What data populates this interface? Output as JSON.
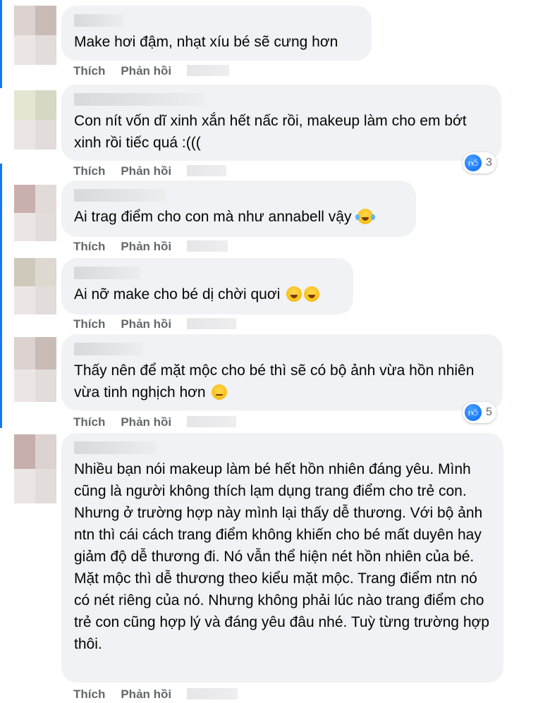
{
  "comments": [
    {
      "text": "Make hơi đậm, nhạt xíu bé sẽ cưng hơn",
      "like_label": "Thích",
      "reply_label": "Phản hồi"
    },
    {
      "text": "Con nít vốn dĩ xinh xắn hết nấc rồi, makeup làm cho em bớt xinh rồi tiếc quá :(((",
      "like_label": "Thích",
      "reply_label": "Phản hồi",
      "reaction_count": "3"
    },
    {
      "text": "Ai trag điểm cho con mà như annabell vậy",
      "like_label": "Thích",
      "reply_label": "Phản hồi",
      "emoji": "laughing-crying-emoji"
    },
    {
      "text": "Ai nỡ make cho bé dị chời quơi",
      "like_label": "Thích",
      "reply_label": "Phản hồi",
      "emoji": "grinning-squinting-emoji"
    },
    {
      "text": "Thấy nên để mặt mộc cho bé thì sẽ có bộ ảnh vừa hồn nhiên vừa tinh nghịch hơn",
      "like_label": "Thích",
      "reply_label": "Phản hồi",
      "reaction_count": "5",
      "emoji": "relieved-face-emoji"
    },
    {
      "text": "Nhiều bạn nói makeup làm bé hết hồn nhiên đáng yêu. Mình cũng là người không thích lạm dụng trang điểm cho trẻ con. Nhưng ở trường hợp này mình lại thấy dễ thương. Với bộ ảnh ntn thì cái cách trang điểm không khiến cho bé mất duyên hay giảm độ dễ thương đi. Nó vẫn thể hiện nét hồn nhiên của bé.\nMặt mộc thì dễ thương theo kiểu mặt mộc. Trang điểm ntn nó có nét riêng của nó. Nhưng không phải lúc nào trang điểm cho trẻ con cũng hợp lý và đáng yêu đâu nhé. Tuỳ từng trường hợp thôi.",
      "like_label": "Thích",
      "reply_label": "Phản hồi"
    }
  ],
  "reaction_icon": "like-thumb-icon",
  "colors": {
    "bubble": "#f0f2f5",
    "action_text": "#65676b",
    "like_blue": "#0866ff"
  }
}
